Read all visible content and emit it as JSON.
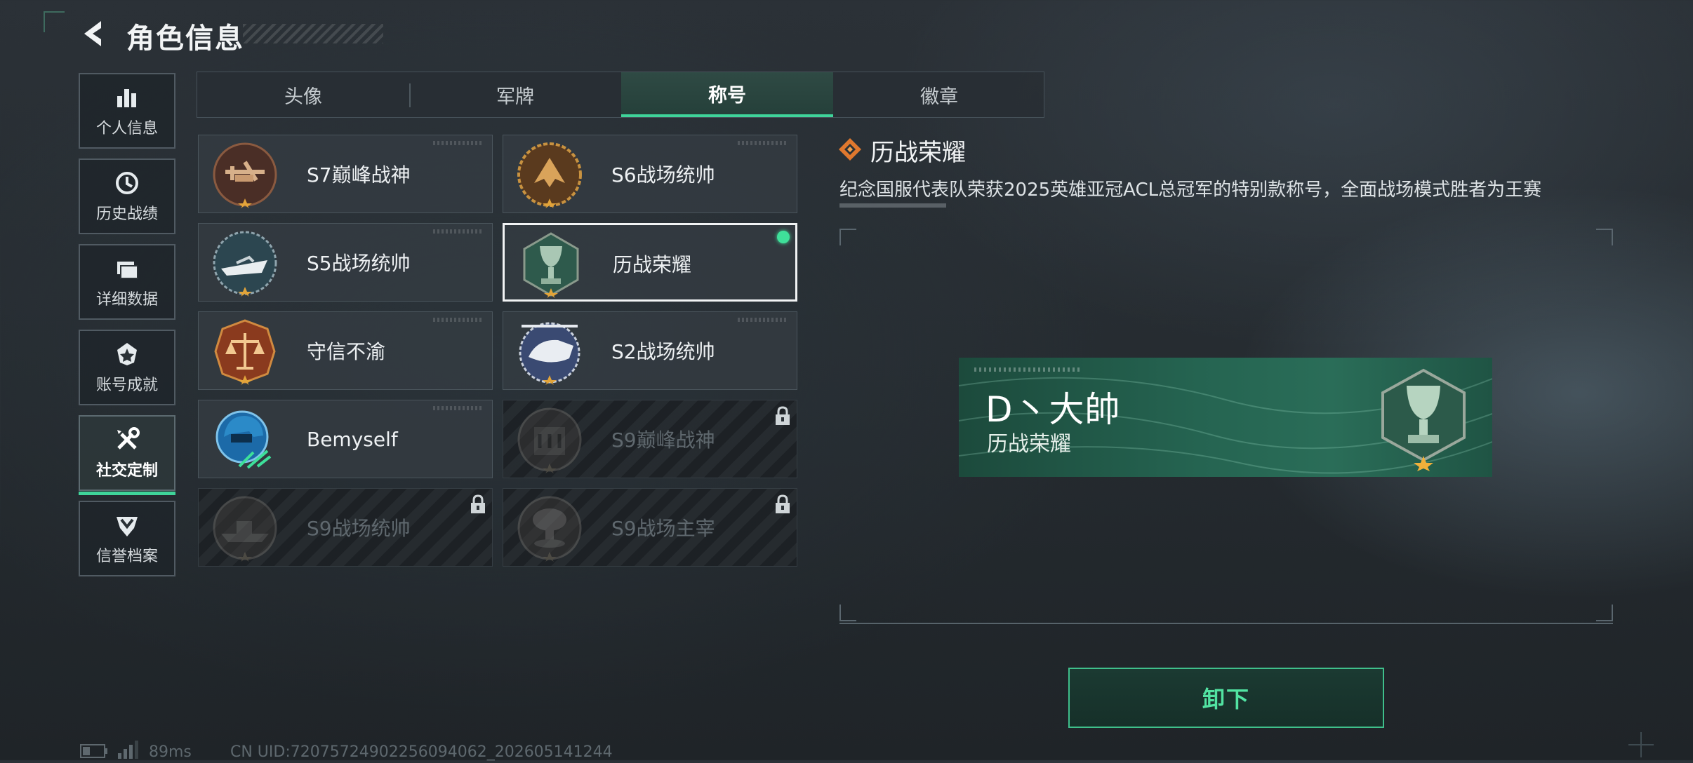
{
  "header": {
    "title": "角色信息"
  },
  "nav": {
    "items": [
      {
        "label": "个人信息",
        "icon": "bar-chart-icon"
      },
      {
        "label": "历史战绩",
        "icon": "clock-history-icon"
      },
      {
        "label": "详细数据",
        "icon": "folder-icon"
      },
      {
        "label": "账号成就",
        "icon": "achievement-badge-icon"
      },
      {
        "label": "社交定制",
        "icon": "wrench-screwdriver-icon",
        "active": true
      },
      {
        "label": "信誉档案",
        "icon": "shield-chevron-icon"
      }
    ]
  },
  "tabs": [
    {
      "label": "头像"
    },
    {
      "label": "军牌"
    },
    {
      "label": "称号",
      "active": true
    },
    {
      "label": "徽章"
    }
  ],
  "titles": [
    {
      "name": "S7巅峰战神",
      "emblem": "crossbow-medal-icon",
      "locked": false
    },
    {
      "name": "S6战场统帅",
      "emblem": "jet-medal-icon",
      "locked": false
    },
    {
      "name": "S5战场统帅",
      "emblem": "speedboat-medal-icon",
      "locked": false
    },
    {
      "name": "历战荣耀",
      "emblem": "trophy-hexagon-icon",
      "locked": false,
      "selected": true,
      "equipped": true
    },
    {
      "name": "守信不渝",
      "emblem": "scales-medal-icon",
      "locked": false
    },
    {
      "name": "S2战场统帅",
      "emblem": "helicopter-medal-icon",
      "locked": false
    },
    {
      "name": "Bemyself",
      "emblem": "soldier-helmet-icon",
      "locked": false
    },
    {
      "name": "S9巅峰战神",
      "emblem": "building-medal-icon",
      "locked": true
    },
    {
      "name": "S9战场统帅",
      "emblem": "warship-medal-icon",
      "locked": true
    },
    {
      "name": "S9战场主宰",
      "emblem": "mushroom-cloud-medal-icon",
      "locked": true
    }
  ],
  "detail": {
    "title": "历战荣耀",
    "description": "纪念国服代表队荣获2025英雄亚冠ACL总冠军的特别款称号，全面战场模式胜者为王赛"
  },
  "preview": {
    "player_name": "D丶大帥",
    "title": "历战荣耀"
  },
  "actions": {
    "unequip_label": "卸下"
  },
  "footer": {
    "ping": "89ms",
    "uid": "CN UID:72075724902256094062_202605141244"
  },
  "colors": {
    "accent": "#3fd49a",
    "equipped_dot": "#3fe09a",
    "plate": "#256451"
  }
}
